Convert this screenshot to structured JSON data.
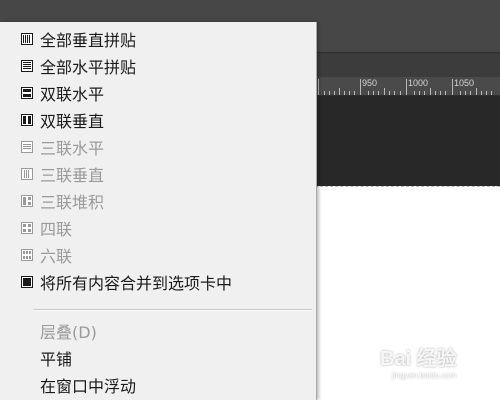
{
  "ruler": {
    "labels": [
      "950",
      "1000",
      "1050"
    ]
  },
  "menu": {
    "items": [
      {
        "label": "全部垂直拼贴",
        "icon": "tile-vertical-all-icon",
        "enabled": true
      },
      {
        "label": "全部水平拼贴",
        "icon": "tile-horizontal-all-icon",
        "enabled": true
      },
      {
        "label": "双联水平",
        "icon": "two-up-horizontal-icon",
        "enabled": true
      },
      {
        "label": "双联垂直",
        "icon": "two-up-vertical-icon",
        "enabled": true
      },
      {
        "label": "三联水平",
        "icon": "three-up-horizontal-icon",
        "enabled": false
      },
      {
        "label": "三联垂直",
        "icon": "three-up-vertical-icon",
        "enabled": false
      },
      {
        "label": "三联堆积",
        "icon": "three-up-stacked-icon",
        "enabled": false
      },
      {
        "label": "四联",
        "icon": "four-up-icon",
        "enabled": false
      },
      {
        "label": "六联",
        "icon": "six-up-icon",
        "enabled": false
      },
      {
        "label": "将所有内容合并到选项卡中",
        "icon": "consolidate-tabs-icon",
        "enabled": true
      }
    ],
    "items2": [
      {
        "label": "层叠(D)",
        "enabled": false
      },
      {
        "label": "平铺",
        "enabled": true
      },
      {
        "label": "在窗口中浮动",
        "enabled": true
      }
    ]
  },
  "watermark": {
    "brand": "Bai 经验",
    "url": "jingyan.baidu.com"
  }
}
